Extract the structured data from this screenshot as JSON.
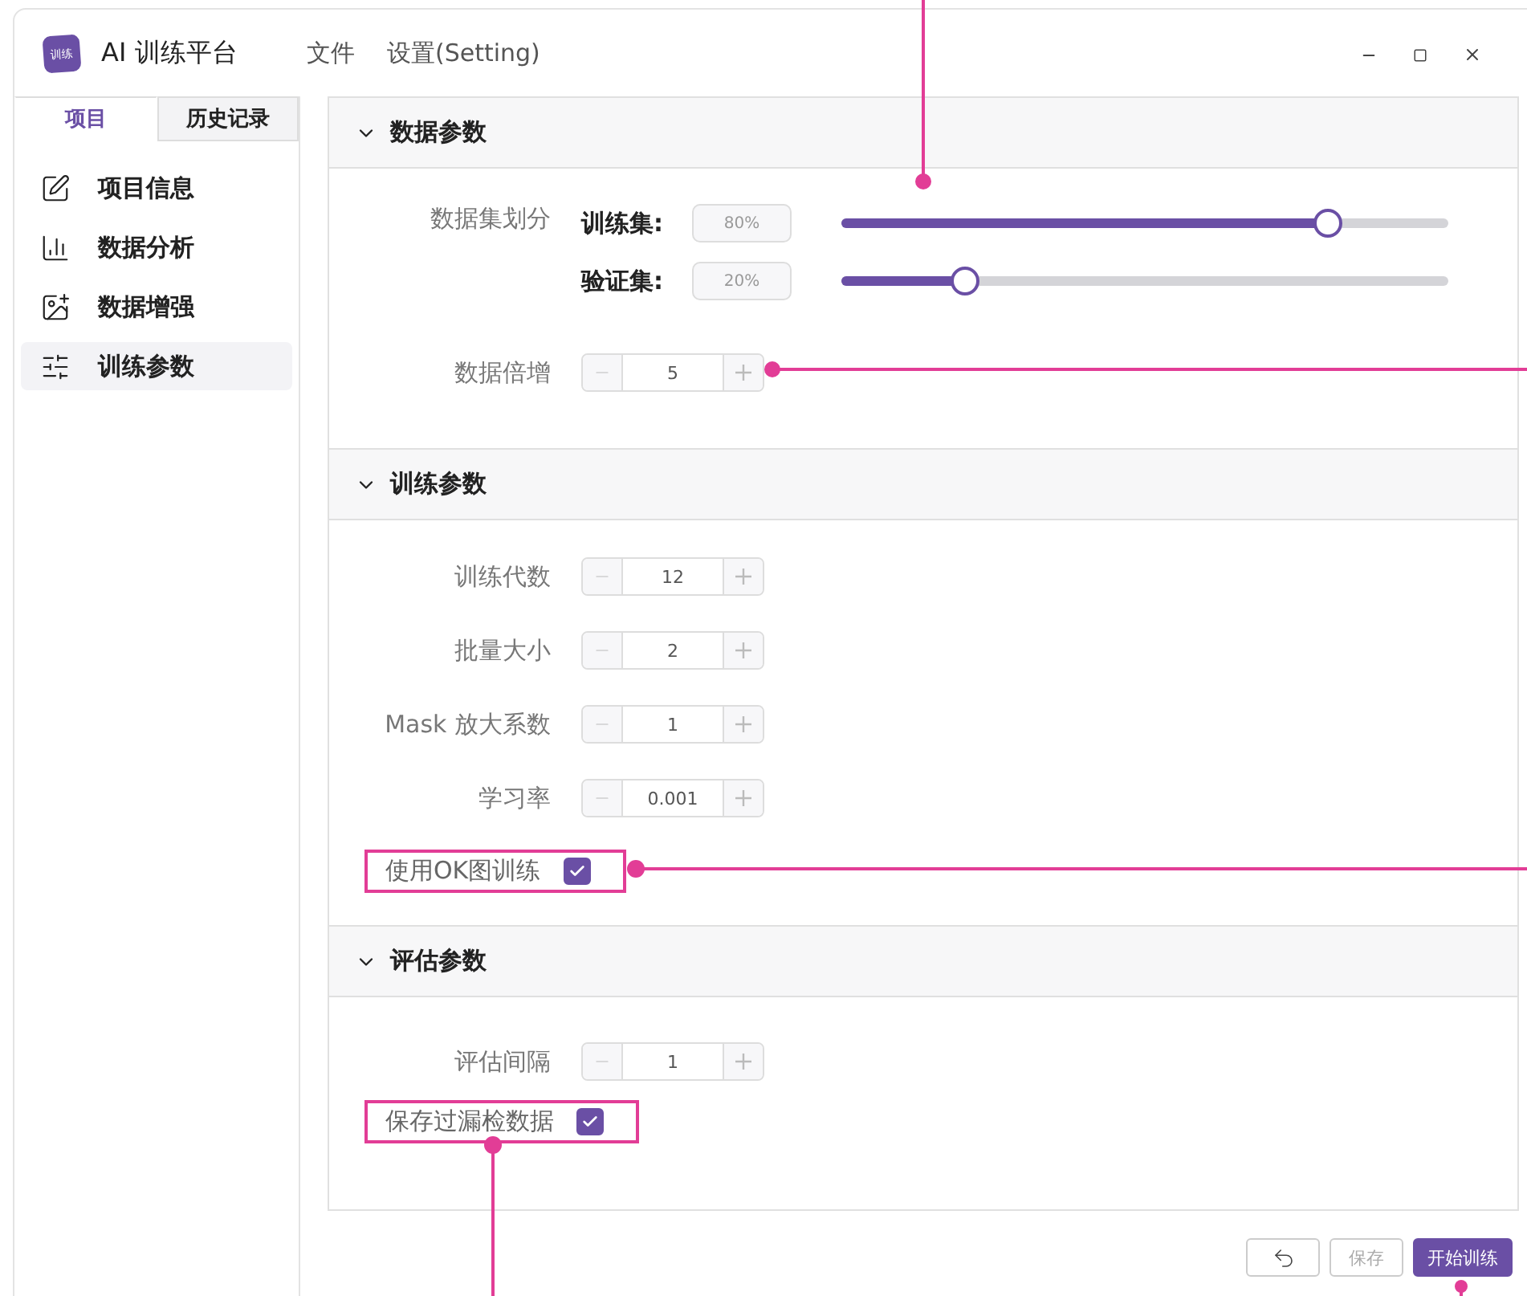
{
  "app": {
    "logo_text": "训练",
    "title": "AI 训练平台"
  },
  "menu": [
    "文件",
    "设置(Setting)"
  ],
  "sidebar": {
    "tabs": [
      {
        "label": "项目",
        "selected": true
      },
      {
        "label": "历史记录",
        "selected": false
      }
    ],
    "items": [
      {
        "label": "项目信息",
        "selected": false
      },
      {
        "label": "数据分析",
        "selected": false
      },
      {
        "label": "数据增强",
        "selected": false
      },
      {
        "label": "训练参数",
        "selected": true
      }
    ]
  },
  "sections": [
    {
      "title": "数据参数",
      "expanded": true,
      "rows": [
        {
          "kind": "split",
          "label": "数据集划分",
          "splits": [
            {
              "label": "训练集:",
              "value": "80%",
              "level": 0.8
            },
            {
              "label": "验证集:",
              "value": "20%",
              "level": 0.2
            }
          ]
        },
        {
          "kind": "stepper",
          "label": "数据倍增",
          "value": "5"
        }
      ]
    },
    {
      "title": "训练参数",
      "expanded": true,
      "rows": [
        {
          "kind": "stepper",
          "label": "训练代数",
          "value": "12"
        },
        {
          "kind": "stepper",
          "label": "批量大小",
          "value": "2"
        },
        {
          "kind": "stepper",
          "label": "Mask 放大系数",
          "value": "1"
        },
        {
          "kind": "stepper",
          "label": "学习率",
          "value": "0.001"
        },
        {
          "kind": "checkbox",
          "label": "使用OK图训练",
          "checked": true,
          "highlighted": true
        }
      ]
    },
    {
      "title": "评估参数",
      "expanded": true,
      "rows": [
        {
          "kind": "stepper",
          "label": "评估间隔",
          "value": "1"
        },
        {
          "kind": "checkbox",
          "label": "保存过漏检数据",
          "checked": true,
          "highlighted": true
        }
      ]
    }
  ],
  "footer": [
    {
      "kind": "undo"
    },
    {
      "kind": "text",
      "label": "保存",
      "disabled": true
    },
    {
      "kind": "primary",
      "label": "开始训练"
    }
  ]
}
